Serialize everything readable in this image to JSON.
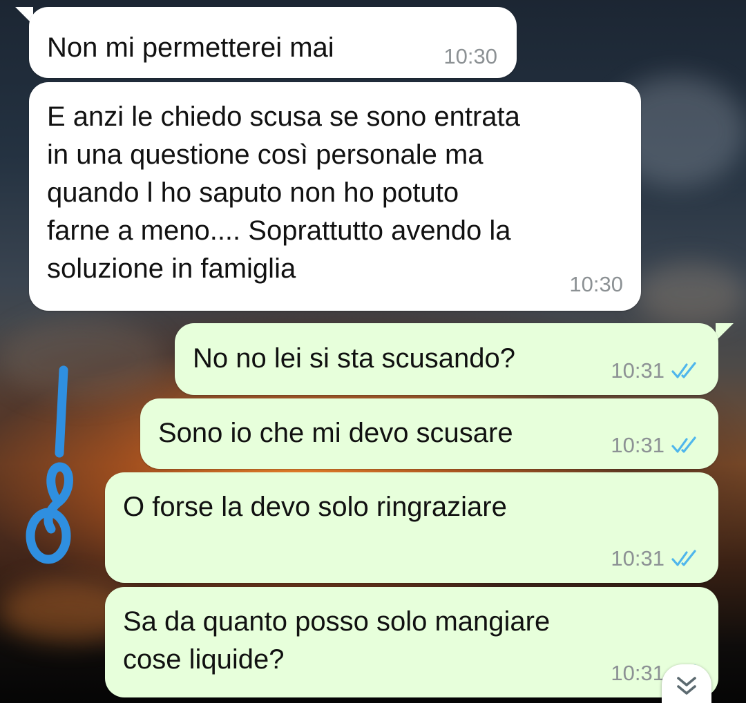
{
  "messages": [
    {
      "direction": "incoming",
      "text": "Non mi permetterei mai",
      "time": "10:30"
    },
    {
      "direction": "incoming",
      "text": "E anzi le chiedo scusa se sono entrata\nin una questione così personale ma\nquando l ho saputo non ho potuto\nfarne a meno.... Soprattutto avendo la\nsoluzione in famiglia",
      "time": "10:30"
    },
    {
      "direction": "outgoing",
      "text": "No no lei si sta scusando?",
      "time": "10:31",
      "status": "read"
    },
    {
      "direction": "outgoing",
      "text": "Sono io che mi devo scusare",
      "time": "10:31",
      "status": "read"
    },
    {
      "direction": "outgoing",
      "text": "O forse la devo solo ringraziare",
      "time": "10:31",
      "status": "read"
    },
    {
      "direction": "outgoing",
      "text": "Sa da quanto posso solo mangiare\ncose liquide?",
      "time": "10:31",
      "status": "read"
    }
  ],
  "colors": {
    "incoming_bubble": "#ffffff",
    "outgoing_bubble": "#e7ffdb",
    "timestamp": "#8c9194",
    "read_ticks": "#4fb6ec",
    "drawing_stroke": "#2f8fe0"
  },
  "icons": {
    "read_receipt": "double-check-icon",
    "scroll_down": "double-chevron-down-icon",
    "annotation": "noose-drawing"
  }
}
